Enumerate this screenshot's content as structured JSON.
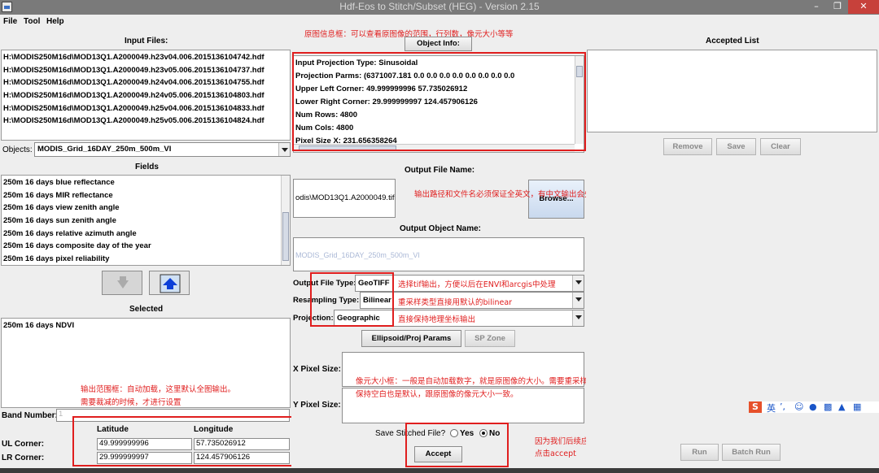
{
  "window": {
    "title": "Hdf-Eos to Stitch/Subset (HEG) - Version 2.15",
    "minimize": "–",
    "maximize": "❐",
    "close": "✕"
  },
  "menu": [
    "File",
    "Tool",
    "Help"
  ],
  "left": {
    "input_files_label": "Input Files:",
    "input_files": [
      "H:\\MODIS250M16d\\MOD13Q1.A2000049.h23v04.006.2015136104742.hdf",
      "H:\\MODIS250M16d\\MOD13Q1.A2000049.h23v05.006.2015136104737.hdf",
      "H:\\MODIS250M16d\\MOD13Q1.A2000049.h24v04.006.2015136104755.hdf",
      "H:\\MODIS250M16d\\MOD13Q1.A2000049.h24v05.006.2015136104803.hdf",
      "H:\\MODIS250M16d\\MOD13Q1.A2000049.h25v04.006.2015136104833.hdf",
      "H:\\MODIS250M16d\\MOD13Q1.A2000049.h25v05.006.2015136104824.hdf"
    ],
    "objects_label": "Objects:",
    "objects_value": "MODIS_Grid_16DAY_250m_500m_VI",
    "fields_label": "Fields",
    "fields": [
      "250m 16 days blue reflectance",
      "250m 16 days MIR reflectance",
      "250m 16 days view zenith angle",
      "250m 16 days sun zenith angle",
      "250m 16 days relative azimuth angle",
      "250m 16 days composite day of the year",
      "250m 16 days pixel reliability"
    ],
    "selected_label": "Selected",
    "selected": [
      "250m 16 days NDVI"
    ],
    "band_number_label": "Band Number:",
    "band_number_value": "1",
    "latitude_label": "Latitude",
    "longitude_label": "Longitude",
    "ul_label": "UL Corner:",
    "lr_label": "LR Corner:",
    "ul_lat": "49.999999996",
    "ul_lon": "57.735026912",
    "lr_lat": "29.999999997",
    "lr_lon": "124.457906126",
    "note_range_1": "输出范围框：自动加载，这里默认全图输出。",
    "note_range_2": "需要裁减的时候，才进行设置"
  },
  "middle": {
    "note_object_info": "原图信息框：可以查看原图像的范围，行列数，像元大小等等",
    "object_info_button": "Object Info:",
    "info_lines": [
      "Input Projection Type:  Sinusoidal",
      "Projection Parms:  (6371007.181  0.0  0.0  0.0  0.0  0.0  0.0  0.0  0.0",
      "Upper Left Corner:  49.999999996    57.735026912",
      "Lower Right Corner:  29.999999997    124.457906126",
      "Num Rows:  4800",
      "Num Cols:  4800",
      "Pixel Size X:  231.656358264"
    ],
    "output_file_label": "Output File Name:",
    "output_file_value": "odis\\MOD13Q1.A2000049.tif",
    "browse_button": "Browse...",
    "note_output_path": "输出路径和文件名必须保证全英文，有中文输出会失败",
    "output_object_label": "Output Object Name:",
    "output_object_value": "MODIS_Grid_16DAY_250m_500m_VI",
    "output_type_label": "Output File Type:",
    "output_type_value": "GeoTIFF",
    "note_output_type": "选择tif输出，方便以后在ENVI和arcgis中处理",
    "resampling_label": "Resampling Type:",
    "resampling_value": "Bilinear",
    "note_resampling": "重采样类型直接用默认的bilinear",
    "projection_label": "Projection:",
    "projection_value": "Geographic",
    "note_projection": "直接保持地理坐标输出",
    "ellipsoid_button": "Ellipsoid/Proj Params",
    "sp_zone_button": "SP Zone",
    "x_pixel_label": "X Pixel Size:",
    "y_pixel_label": "Y Pixel Size:",
    "note_pixel_1": "像元大小框：一般是自动加载数字，就是原图像的大小。需要重采样像元大小的可以自行输入。",
    "note_pixel_2": "保持空白也是默认，跟原图像的像元大小一致。",
    "save_stitched_label": "Save Stitched File?",
    "yes_label": "Yes",
    "no_label": "No",
    "accept_button": "Accept",
    "note_accept_1": "因为我们后续应该不用到hdf数据，所以选择no，只输出tif",
    "note_accept_2": "点击accept"
  },
  "right": {
    "accepted_list_label": "Accepted List",
    "remove_button": "Remove",
    "save_button": "Save",
    "clear_button": "Clear",
    "run_button": "Run",
    "batch_run_button": "Batch Run"
  },
  "ime": {
    "logo": "S",
    "lang": "英"
  },
  "colors": {
    "annotation": "#e01e1e",
    "titlebar": "#7a7a7a",
    "close": "#c7413b"
  }
}
